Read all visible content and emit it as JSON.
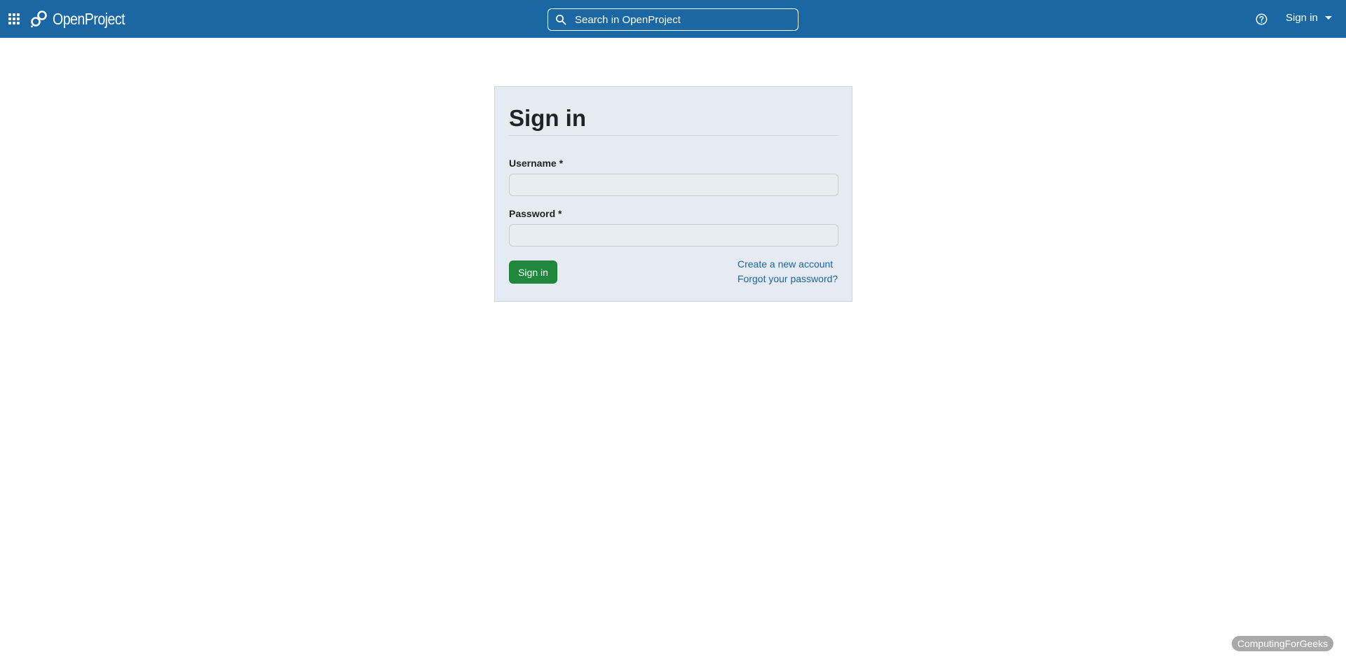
{
  "header": {
    "brand": "OpenProject",
    "search_placeholder": "Search in OpenProject",
    "account_menu_label": "Sign in",
    "colors": {
      "bar": "#1a67a3"
    },
    "icons": [
      "app-grid-icon",
      "openproject-logo",
      "search-icon",
      "help-icon",
      "caret-down-icon"
    ]
  },
  "login": {
    "title": "Sign in",
    "username_label": "Username *",
    "username_value": "",
    "password_label": "Password *",
    "password_value": "",
    "submit_label": "Sign in",
    "create_account_link": "Create a new account",
    "forgot_password_link": "Forgot your password?",
    "colors": {
      "panel": "#e6eaf2",
      "primary_button": "#1f883d",
      "link": "#1a67a3"
    }
  },
  "watermark": "ComputingForGeeks"
}
